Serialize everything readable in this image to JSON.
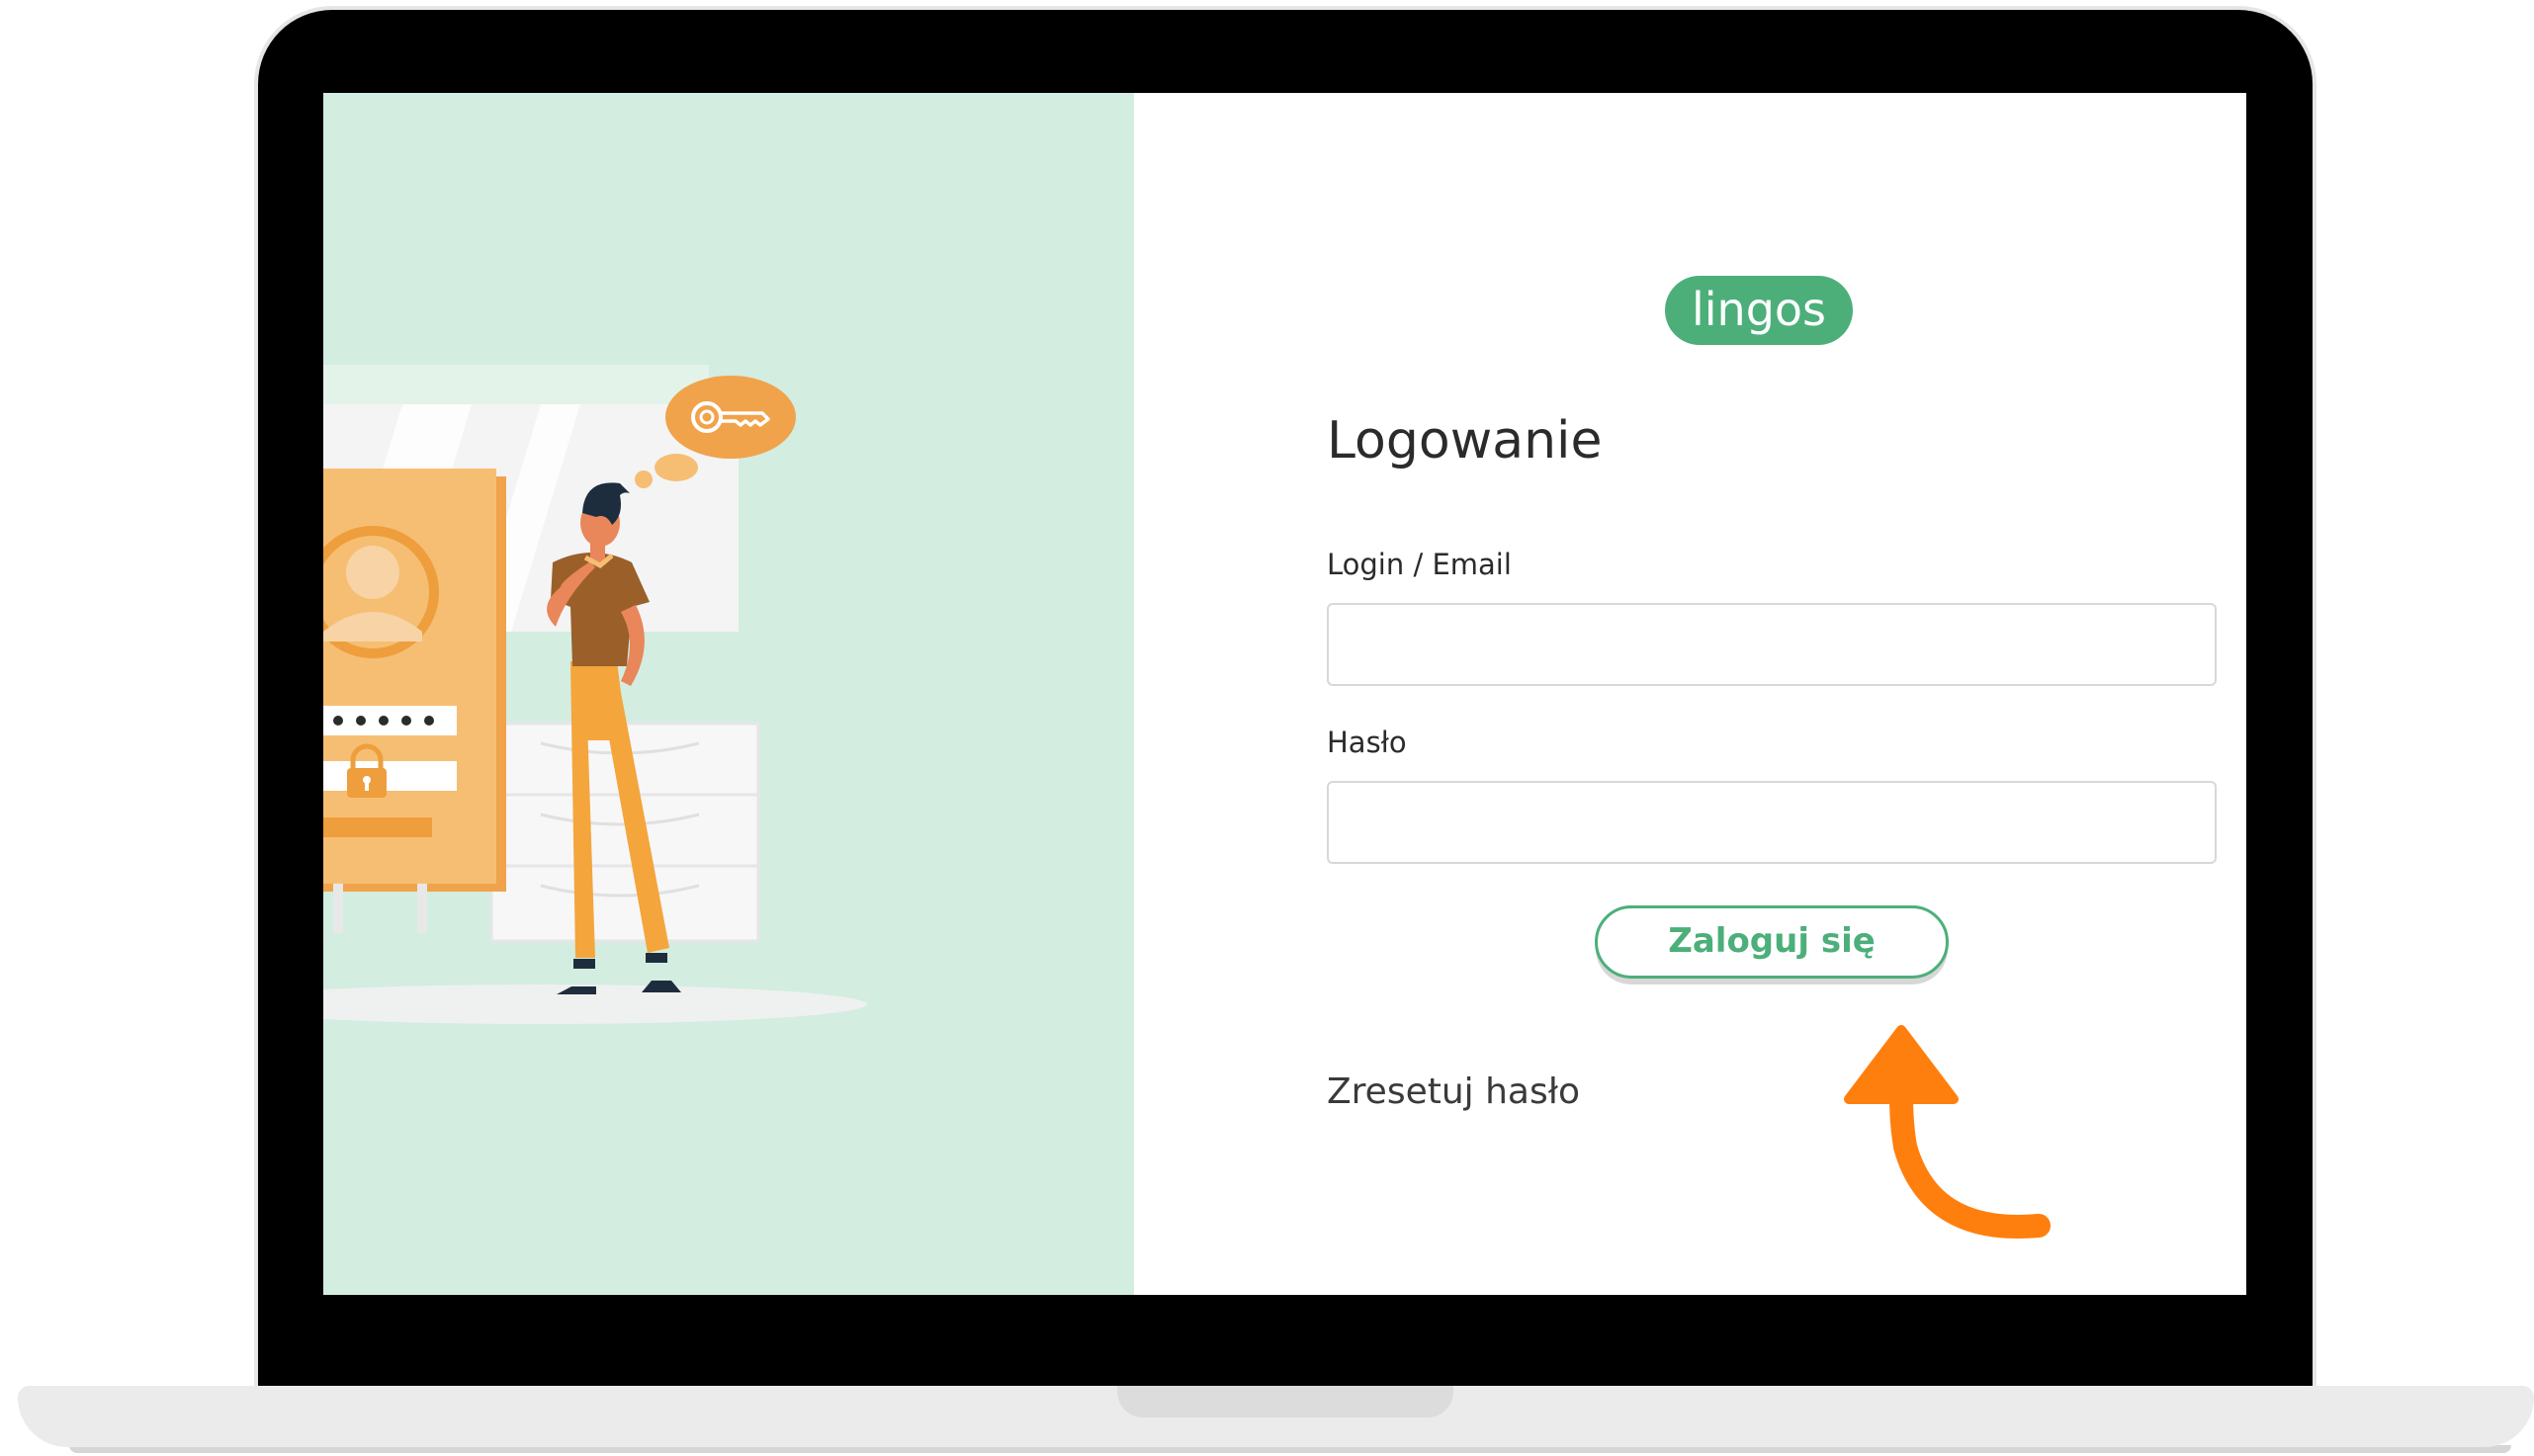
{
  "app": {
    "logo_text": "lingos"
  },
  "login_form": {
    "title": "Logowanie",
    "login_label": "Login / Email",
    "login_value": "",
    "password_label": "Hasło",
    "password_value": "",
    "submit_label": "Zaloguj się",
    "reset_link": "Zresetuj hasło"
  },
  "colors": {
    "brand_green": "#4caf7a",
    "illustration_bg": "#d3ede1",
    "annotation_orange": "#ff7f0e",
    "illustration_orange": "#f5a43b"
  },
  "icons": {
    "key": "key-icon",
    "lock": "lock-icon",
    "user": "user-avatar-icon",
    "arrow": "curved-arrow-icon"
  }
}
